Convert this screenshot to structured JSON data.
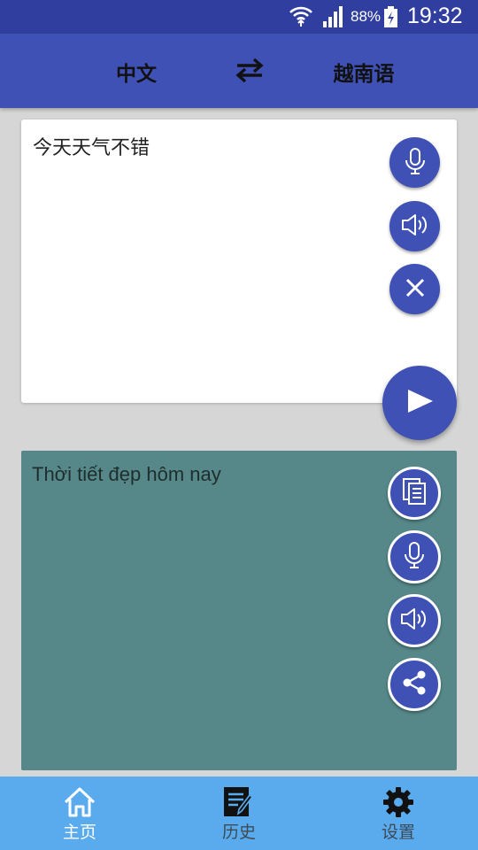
{
  "status_bar": {
    "battery_percent": "88%",
    "time": "19:32",
    "icons": [
      "wifi-icon",
      "signal-icon",
      "battery-charging-icon"
    ]
  },
  "toolbar": {
    "source_language": "中文",
    "target_language": "越南语",
    "swap_icon": "swap-arrows-icon"
  },
  "input": {
    "text": "今天天气不错",
    "actions": [
      "microphone-icon",
      "speaker-icon",
      "clear-icon"
    ],
    "translate_icon": "play-icon"
  },
  "output": {
    "text": "Thời tiết đẹp hôm nay",
    "actions": [
      "copy-icon",
      "microphone-icon",
      "speaker-icon",
      "share-icon"
    ]
  },
  "bottom_nav": {
    "items": [
      {
        "label": "主页",
        "icon": "home-icon",
        "active": true
      },
      {
        "label": "历史",
        "icon": "history-icon",
        "active": false
      },
      {
        "label": "设置",
        "icon": "gear-icon",
        "active": false
      }
    ]
  },
  "colors": {
    "status_bar": "#303f9f",
    "primary": "#3f51b5",
    "output_background": "#568889",
    "bottom_nav": "#5aabee",
    "page_background": "#d6d6d6"
  }
}
